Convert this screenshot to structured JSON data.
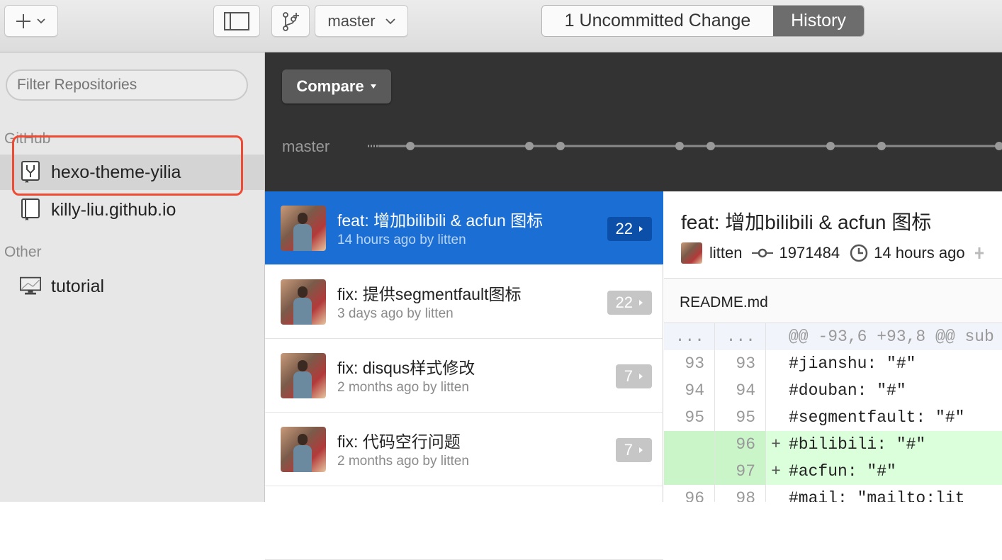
{
  "toolbar": {
    "add_icon": "plus-icon",
    "branch_label": "master",
    "tab_changes": "1 Uncommitted Change",
    "tab_history": "History"
  },
  "sidebar": {
    "filter_placeholder": "Filter Repositories",
    "section_github": "GitHub",
    "section_other": "Other",
    "repos": [
      {
        "name": "hexo-theme-yilia",
        "icon": "repo-fork-icon"
      },
      {
        "name": "killy-liu.github.io",
        "icon": "repo-book-icon"
      }
    ],
    "other_repos": [
      {
        "name": "tutorial",
        "icon": "monitor-icon"
      }
    ]
  },
  "timeline": {
    "compare_label": "Compare",
    "branch": "master"
  },
  "commits": [
    {
      "title": "feat: 增加bilibili & acfun 图标",
      "meta": "14 hours ago by litten",
      "files": "22"
    },
    {
      "title": "fix: 提供segmentfault图标",
      "meta": "3 days ago by litten",
      "files": "22"
    },
    {
      "title": "fix: disqus样式修改",
      "meta": "2 months ago by litten",
      "files": "7"
    },
    {
      "title": "fix: 代码空行问题",
      "meta": "2 months ago by litten",
      "files": "7"
    }
  ],
  "detail": {
    "title": "feat: 增加bilibili & acfun 图标",
    "author": "litten",
    "sha": "1971484",
    "time": "14 hours ago",
    "file": "README.md",
    "diff": [
      {
        "type": "hunk",
        "old": "...",
        "new": "...",
        "sign": "",
        "code": "@@ -93,6 +93,8 @@ sub"
      },
      {
        "type": "ctx",
        "old": "93",
        "new": "93",
        "sign": "",
        "code": "  #jianshu: \"#\""
      },
      {
        "type": "ctx",
        "old": "94",
        "new": "94",
        "sign": "",
        "code": "  #douban: \"#\""
      },
      {
        "type": "ctx",
        "old": "95",
        "new": "95",
        "sign": "",
        "code": "  #segmentfault: \"#\""
      },
      {
        "type": "add",
        "old": "",
        "new": "96",
        "sign": "+",
        "code": "  #bilibili: \"#\""
      },
      {
        "type": "add",
        "old": "",
        "new": "97",
        "sign": "+",
        "code": "  #acfun: \"#\""
      },
      {
        "type": "ctx",
        "old": "96",
        "new": "98",
        "sign": "",
        "code": "  #mail: \"mailto:lit"
      }
    ]
  }
}
